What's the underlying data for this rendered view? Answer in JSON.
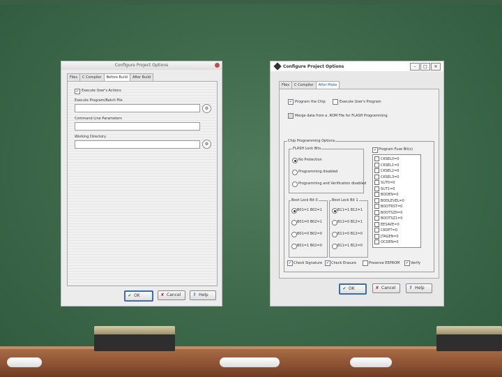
{
  "left_window": {
    "title": "Configure Project Options",
    "tabs": [
      "Files",
      "C Compiler",
      "Before Build",
      "After Build"
    ],
    "active_tab": "Before Build",
    "execute_check_label": "Execute User's Actions",
    "execute_checked": true,
    "program_label": "Execute Program/Batch File",
    "program_value": "",
    "cmdline_label": "Command Line Parameters",
    "cmdline_value": "",
    "workdir_label": "Working Directory",
    "workdir_value": "",
    "ok_label": "OK",
    "cancel_label": "Cancel",
    "help_label": "Help"
  },
  "right_window": {
    "title": "Configure Project Options",
    "tabs": [
      "Files",
      "C Compiler",
      "After Make"
    ],
    "active_tab": "After Make",
    "program_chip_label": "Program the Chip",
    "program_chip_checked": true,
    "execute_user_label": "Execute User's Program",
    "execute_user_checked": false,
    "merge_label": "Merge data from a .ROM File for FLASH Programming",
    "merge_checked": false,
    "chip_group_title": "Chip Programming Options",
    "flash_group_title": "FLASH Lock Bits",
    "flash_options": [
      "No Protection",
      "Programming disabled",
      "Programming and Verification disabled"
    ],
    "flash_selected": 0,
    "bootlock0_title": "Boot Lock Bit 0",
    "bootlock0_options": [
      "B01=1 B02=1",
      "B01=0 B02=1",
      "B01=0 B02=0",
      "B01=1 B02=0"
    ],
    "bootlock0_selected": 0,
    "bootlock1_title": "Boot Lock Bit 1",
    "bootlock1_options": [
      "B11=1 B12=1",
      "B11=0 B12=1",
      "B11=0 B12=0",
      "B11=1 B12=0"
    ],
    "bootlock1_selected": 0,
    "fuse_title": "Program Fuse Bit(s)",
    "fuse_checked": true,
    "fuses": [
      "CKSEL0=0",
      "CKSEL1=0",
      "CKSEL2=0",
      "CKSEL3=0",
      "SUT0=0",
      "SUT1=0",
      "BODEN=0",
      "BODLEVEL=0",
      "BOOTRST=0",
      "BOOTSZ0=0",
      "BOOTSZ1=0",
      "EESAVE=0",
      "CKOPT=0",
      "JTAGEN=0",
      "OCDEN=0"
    ],
    "bottom_checks": [
      {
        "label": "Check Signature",
        "checked": true
      },
      {
        "label": "Check Erasure",
        "checked": true
      },
      {
        "label": "Preserve EEPROM",
        "checked": false
      },
      {
        "label": "Verify",
        "checked": true
      }
    ],
    "ok_label": "OK",
    "cancel_label": "Cancel",
    "help_label": "Help"
  }
}
